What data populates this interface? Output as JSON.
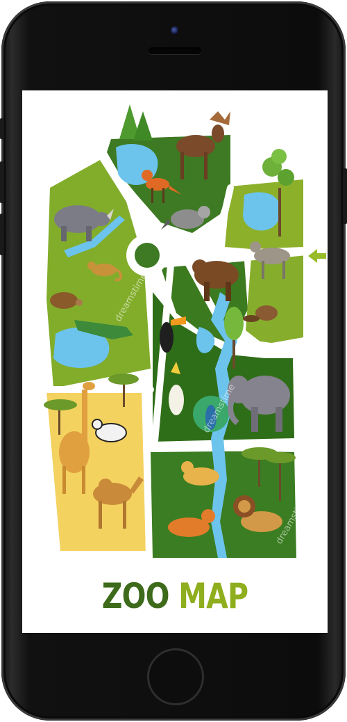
{
  "title": {
    "word1": "ZOO",
    "word2": "MAP"
  },
  "watermark": "dreamstime",
  "colors": {
    "dark_green": "#3e6b1b",
    "light_green": "#8fae1e",
    "water": "#6cc3ec",
    "sand": "#f6d76a"
  },
  "zones": [
    "north-forest",
    "west-wetland",
    "savanna",
    "central-forest",
    "tropical-jungle",
    "big-cat-plains"
  ],
  "animals": [
    "moose",
    "fox",
    "raccoon",
    "rhinoceros",
    "chameleon",
    "tortoise",
    "crocodile",
    "bear",
    "wolf",
    "beaver",
    "toucan",
    "cockatoo",
    "peacock",
    "elephant",
    "giraffe",
    "zebra",
    "camel",
    "leopard",
    "tiger",
    "lion"
  ],
  "entrance": "entrance-arrow-icon"
}
